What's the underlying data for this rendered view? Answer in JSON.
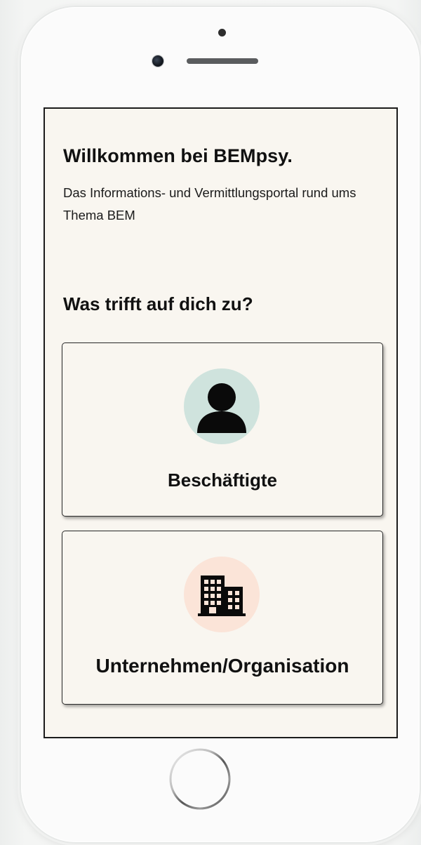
{
  "welcome": {
    "title": "Willkommen bei BEMpsy.",
    "subtitle": "Das Informations- und Vermittlungsportal rund ums Thema BEM"
  },
  "question": "Was trifft auf dich zu?",
  "options": [
    {
      "label": "Beschäftigte",
      "icon": "person-icon",
      "icon_bg": "#cfe3dd"
    },
    {
      "label": "Unternehmen/Organisation",
      "icon": "office-buildings-icon",
      "icon_bg": "#fbe4d8"
    }
  ],
  "colors": {
    "screen_bg": "#f9f6f0",
    "text": "#111111",
    "border": "#1b1b1b"
  }
}
